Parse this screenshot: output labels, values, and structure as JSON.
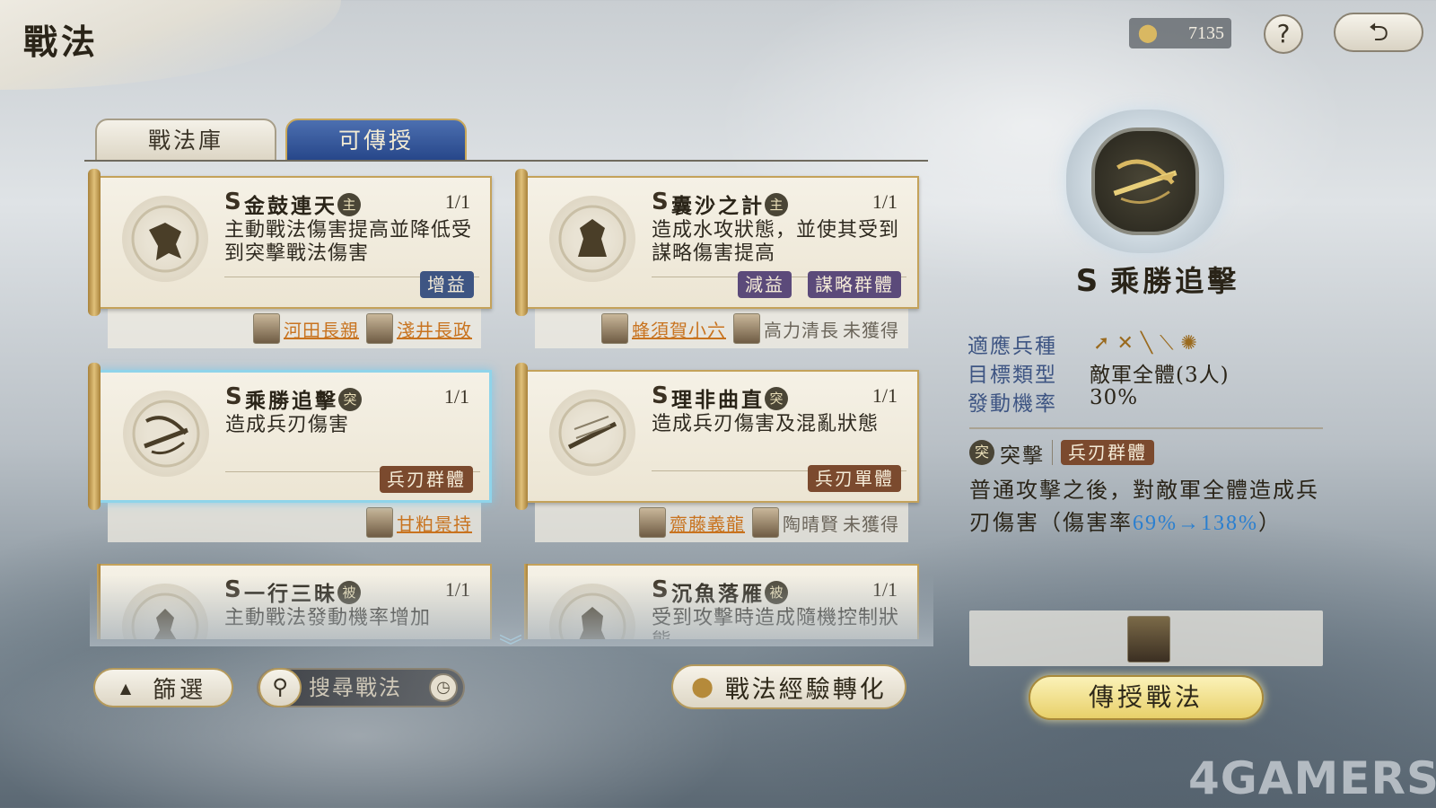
{
  "header": {
    "title": "戰法",
    "currency_value": "7135",
    "currency_icon": "coin-icon",
    "help_label": "?",
    "back_icon": "return-arrow-icon"
  },
  "tabs": [
    {
      "label": "戰法庫",
      "active": false
    },
    {
      "label": "可傳授",
      "active": true
    }
  ],
  "cards": [
    {
      "rank": "S",
      "name": "金鼓連天",
      "type_badge": "主",
      "count": "1/1",
      "desc": "主動戰法傷害提高並降低受到突擊戰法傷害",
      "tags": [
        {
          "label": "增益",
          "color": "blue"
        }
      ],
      "owners": [
        {
          "name": "河田長親",
          "status": ""
        },
        {
          "name": "淺井長政",
          "status": ""
        }
      ]
    },
    {
      "rank": "S",
      "name": "囊沙之計",
      "type_badge": "主",
      "count": "1/1",
      "desc": "造成水攻狀態，並使其受到謀略傷害提高",
      "tags": [
        {
          "label": "減益",
          "color": "purple"
        },
        {
          "label": "謀略群體",
          "color": "purple"
        }
      ],
      "owners": [
        {
          "name": "蜂須賀小六",
          "status": ""
        },
        {
          "name": "高力清長",
          "status": "未獲得"
        }
      ]
    },
    {
      "rank": "S",
      "name": "乘勝追擊",
      "type_badge": "突",
      "count": "1/1",
      "desc": "造成兵刃傷害",
      "tags": [
        {
          "label": "兵刃群體",
          "color": "brown"
        }
      ],
      "owners": [
        {
          "name": "甘粕景持",
          "status": ""
        }
      ]
    },
    {
      "rank": "S",
      "name": "理非曲直",
      "type_badge": "突",
      "count": "1/1",
      "desc": "造成兵刃傷害及混亂狀態",
      "tags": [
        {
          "label": "兵刃單體",
          "color": "brown"
        }
      ],
      "owners": [
        {
          "name": "齋藤義龍",
          "status": ""
        },
        {
          "name": "陶晴賢",
          "status": "未獲得"
        }
      ]
    },
    {
      "rank": "S",
      "name": "一行三昧",
      "type_badge": "被",
      "count": "1/1",
      "desc": "主動戰法發動機率增加",
      "tags": [],
      "owners": []
    },
    {
      "rank": "S",
      "name": "沉魚落雁",
      "type_badge": "被",
      "count": "1/1",
      "desc": "受到攻擊時造成隨機控制狀態",
      "tags": [],
      "owners": []
    }
  ],
  "bottom": {
    "filter_label": "篩選",
    "search_placeholder": "搜尋戰法",
    "convert_label": "戰法經驗轉化"
  },
  "detail": {
    "rank": "S",
    "name": "乘勝追擊",
    "troop_label": "適應兵種",
    "troop_icons": [
      "spear-icon",
      "bow-icon",
      "gun-icon",
      "sword-icon",
      "wheel-icon"
    ],
    "target_label": "目標類型",
    "target_value": "敵軍全體(3人)",
    "rate_label": "發動機率",
    "rate_value": "30%",
    "type_badge": "突",
    "type_label": "突擊",
    "tag": "兵刃群體",
    "desc_prefix": "普通攻擊之後，對敵軍全體造成兵刃傷害（傷害率",
    "desc_value": "69%→138%",
    "desc_suffix": "）",
    "teach_label": "傳授戰法"
  },
  "watermark": "4GAMERS"
}
